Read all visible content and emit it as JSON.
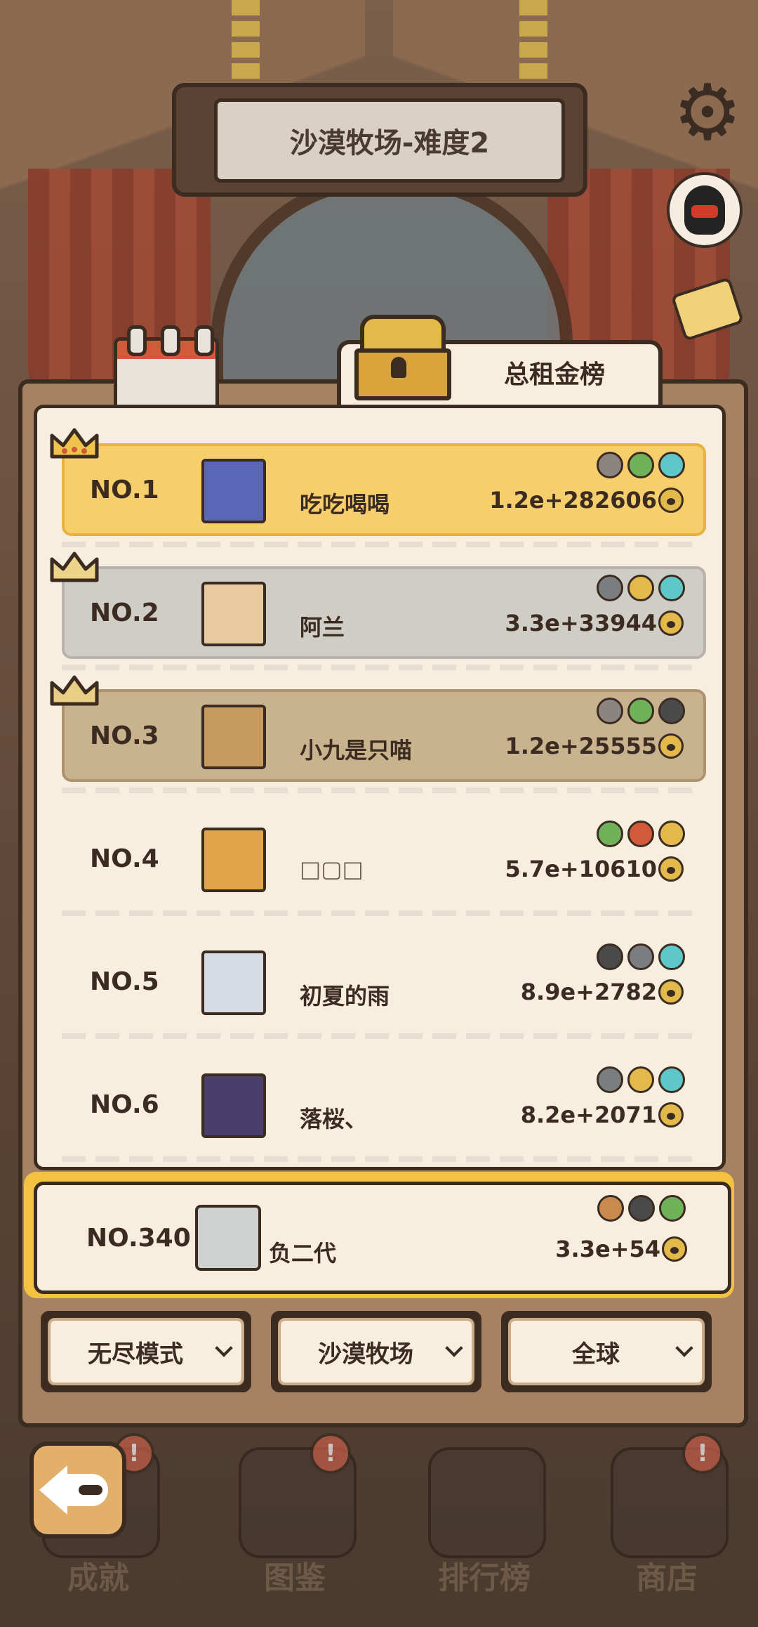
{
  "sign": {
    "title": "沙漠牧场-难度2"
  },
  "tab": {
    "label": "总租金榜"
  },
  "leaderboard": [
    {
      "rank": "NO.1",
      "name": "吃吃喝喝",
      "score": "1.2e+282606",
      "tier": "gold",
      "badges": [
        "#8b8480",
        "#6fb25a",
        "#5ec8c8"
      ],
      "avatar_color": "#5a66b8"
    },
    {
      "rank": "NO.2",
      "name": "阿兰",
      "score": "3.3e+33944",
      "tier": "silver",
      "badges": [
        "#7a7e80",
        "#e3b94c",
        "#5ec8c8"
      ],
      "avatar_color": "#e9c9a0"
    },
    {
      "rank": "NO.3",
      "name": "小九是只喵",
      "score": "1.2e+25555",
      "tier": "bronze",
      "badges": [
        "#8b8480",
        "#6fb25a",
        "#4a4a4a"
      ],
      "avatar_color": "#c79a5e"
    },
    {
      "rank": "NO.4",
      "name": "□▢□",
      "score": "5.7e+10610",
      "tier": "plain",
      "badges": [
        "#6fb25a",
        "#d05a3a",
        "#e3b94c"
      ],
      "avatar_color": "#e0a548"
    },
    {
      "rank": "NO.5",
      "name": "初夏的雨",
      "score": "8.9e+2782",
      "tier": "plain",
      "badges": [
        "#4a4a4a",
        "#7a7e80",
        "#5ec8c8"
      ],
      "avatar_color": "#d7dbe4"
    },
    {
      "rank": "NO.6",
      "name": "落桜、",
      "score": "8.2e+2071",
      "tier": "plain",
      "badges": [
        "#7a7e80",
        "#e3b94c",
        "#5ec8c8"
      ],
      "avatar_color": "#4a3e6a"
    }
  ],
  "my_entry": {
    "rank": "NO.340",
    "name": "负二代",
    "score": "3.3e+54",
    "badges": [
      "#c98a4e",
      "#4a4a4a",
      "#6fb25a"
    ]
  },
  "filters": [
    {
      "label": "无尽模式"
    },
    {
      "label": "沙漠牧场"
    },
    {
      "label": "全球"
    }
  ],
  "nav": [
    {
      "label": "成就"
    },
    {
      "label": "图鉴"
    },
    {
      "label": "排行榜"
    },
    {
      "label": "商店"
    }
  ],
  "nav_alert": "!"
}
